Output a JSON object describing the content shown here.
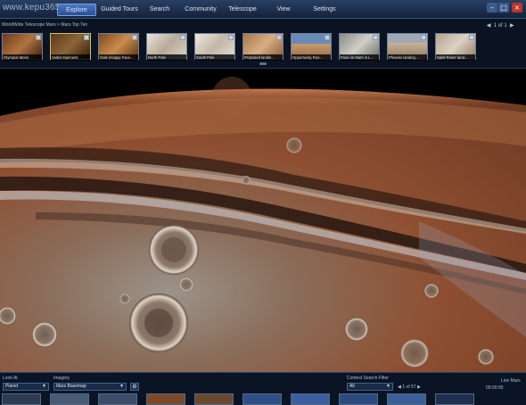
{
  "watermark": "www.kepu365.com",
  "menu": {
    "items": [
      {
        "label": "Explore",
        "active": true
      },
      {
        "label": "Guided Tours",
        "active": false
      },
      {
        "label": "Search",
        "active": false
      },
      {
        "label": "Community",
        "active": false
      },
      {
        "label": "Telescope",
        "active": false
      },
      {
        "label": "View",
        "active": false
      },
      {
        "label": "Settings",
        "active": false
      }
    ]
  },
  "explore": {
    "breadcrumb": "WorldWide Telescope Mars > Mars Top Ten",
    "page_indicator": "1 of 1",
    "thumbnails": [
      {
        "caption": "Olympus Mons",
        "selected": false
      },
      {
        "caption": "Valles Marineris",
        "selected": true
      },
      {
        "caption": "Gale (Happy Face...",
        "selected": false
      },
      {
        "caption": "North Pole",
        "selected": false
      },
      {
        "caption": "South Pole",
        "selected": false
      },
      {
        "caption": "Proposed landin...",
        "selected": false
      },
      {
        "caption": "Opportunity Roo...",
        "selected": false
      },
      {
        "caption": "Face on Mars in L...",
        "selected": false
      },
      {
        "caption": "Phoenix landing ...",
        "selected": false
      },
      {
        "caption": "Spirit Rover land...",
        "selected": false
      }
    ]
  },
  "bottom": {
    "look_at_label": "Look At",
    "look_at_value": "Planet",
    "imagery_label": "Imagery",
    "imagery_value": "Mars Basemap",
    "filter_label": "Context Search Filter",
    "filter_value": "All",
    "page_indicator": "1 of 57",
    "time_label": "Live Mars",
    "time_value": "00:00:00"
  },
  "colors": {
    "menu_bg": "#14223b",
    "accent": "#4a78c2",
    "mars_surface": "#8a4a2e"
  }
}
